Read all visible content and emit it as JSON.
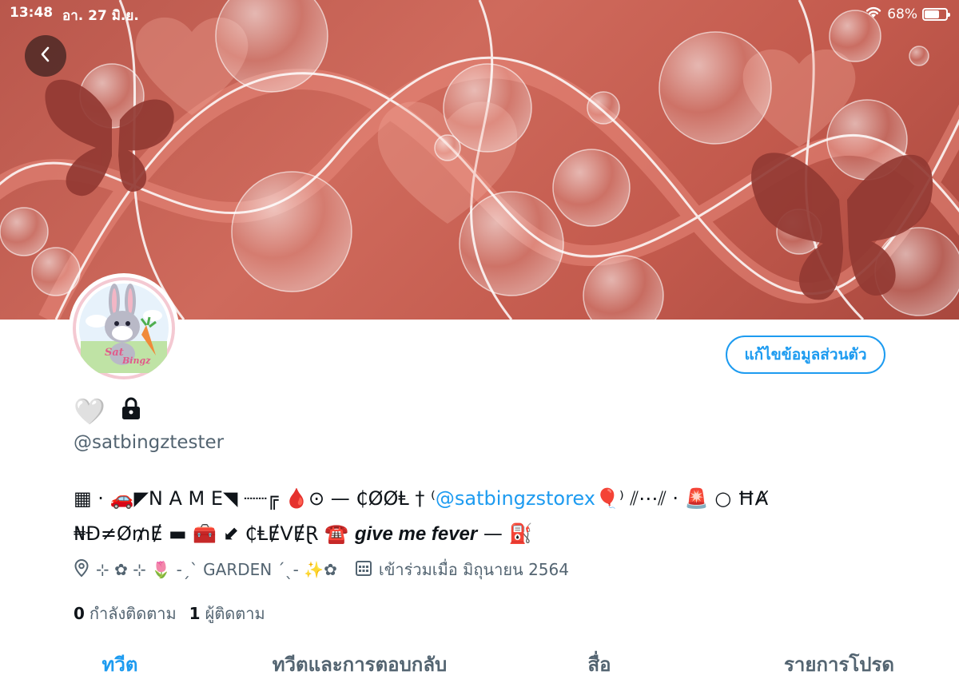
{
  "status_bar": {
    "time": "13:48",
    "date": "อา. 27 มิ.ย.",
    "battery_percent_text": "68%",
    "battery_level": 0.68,
    "icons": [
      "wifi-icon",
      "battery-icon"
    ]
  },
  "header": {
    "back_icon": "chevron-left-icon"
  },
  "avatar": {
    "logo_text": "Satbingz"
  },
  "profile": {
    "edit_button": "แก้ไขข้อมูลส่วนตัว",
    "display_name_emoji": "🤍",
    "lock_icon": "lock-icon",
    "handle": "@satbingztester"
  },
  "bio": {
    "line1_part1": "▦ · 🚗◤N A M E◥ ┈┈╔ 🩸⊙ — ₵ØØⱠ † ⁽",
    "mention": "@satbingzstorex",
    "line1_part2": "🎈⁾ ⫽⋯⫽ · 🚨 ○ ĦȺ",
    "line2_part1": "₦Đ≠Ø₥Ɇ ▬ 🧰 ⬋ ₵ⱠɆVɆⱤ ☎️",
    "fever": "give me fever",
    "line2_part2": "— ⛽"
  },
  "meta": {
    "location_icon": "location-pin-icon",
    "location": "⊹ ✿ ⊹ 🌷 -ˏˋ GARDEN ˊˎ- ✨✿",
    "calendar_icon": "calendar-icon",
    "joined": "เข้าร่วมเมื่อ มิถุนายน 2564"
  },
  "follow": {
    "following_count": "0",
    "following_label": "กำลังติดตาม",
    "followers_count": "1",
    "followers_label": "ผู้ติดตาม"
  },
  "tabs": [
    {
      "label": "ทวีต",
      "active": true
    },
    {
      "label": "ทวีตและการตอบกลับ",
      "active": false
    },
    {
      "label": "สื่อ",
      "active": false
    },
    {
      "label": "รายการโปรด",
      "active": false
    }
  ],
  "colors": {
    "accent": "#1d9bf0",
    "banner": "#c35a4d",
    "text_secondary": "#536471"
  }
}
